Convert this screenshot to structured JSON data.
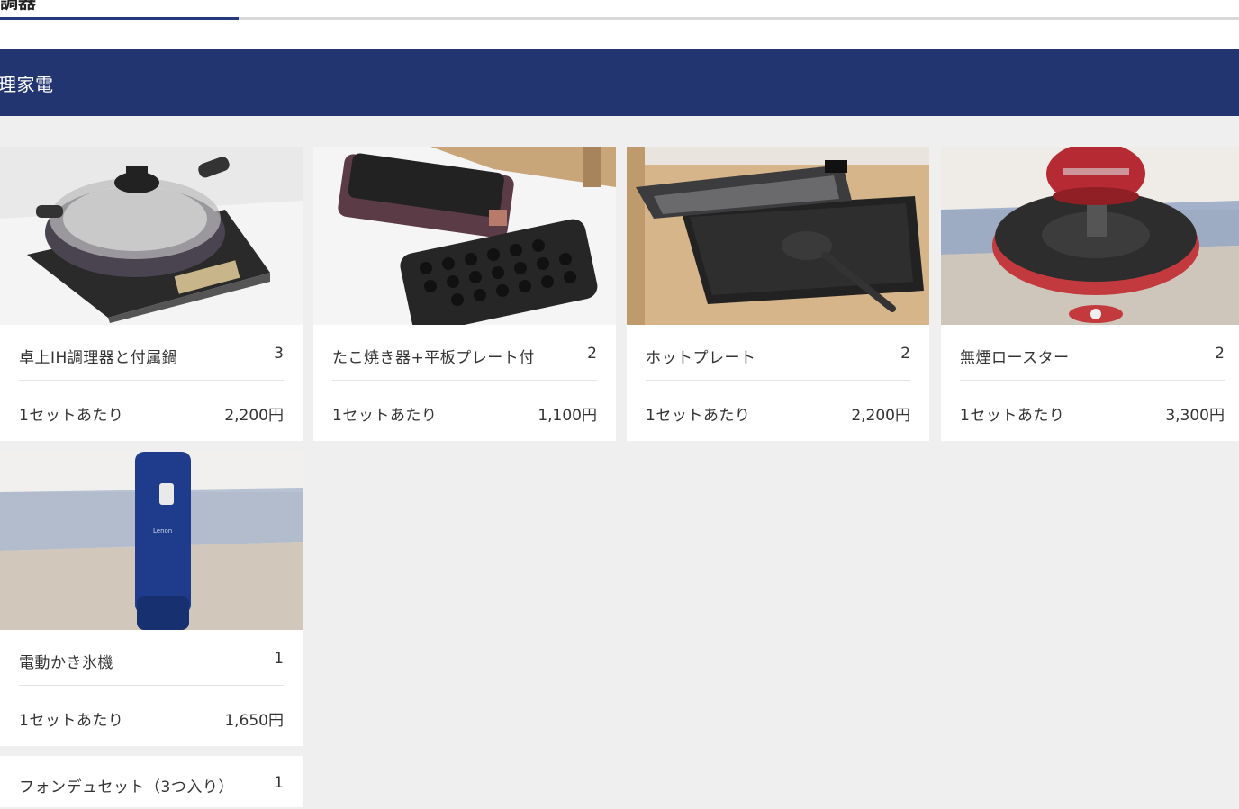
{
  "tab": {
    "title": "調器"
  },
  "category": {
    "label": "理家電"
  },
  "products": [
    {
      "name": "卓上IH調理器と付属鍋",
      "qty": "3",
      "unit": "1セットあたり",
      "price": "2,200円"
    },
    {
      "name": "たこ焼き器+平板プレート付",
      "qty": "2",
      "unit": "1セットあたり",
      "price": "1,100円"
    },
    {
      "name": "ホットプレート",
      "qty": "2",
      "unit": "1セットあたり",
      "price": "2,200円"
    },
    {
      "name": "無煙ロースター",
      "qty": "2",
      "unit": "1セットあたり",
      "price": "3,300円"
    },
    {
      "name": "電動かき氷機",
      "qty": "1",
      "unit": "1セットあたり",
      "price": "1,650円"
    },
    {
      "name": "フォンデュセット（3つ入り）",
      "qty": "1"
    }
  ],
  "colors": {
    "brand_navy": "#233571",
    "tab_active": "#243a7a",
    "page_bg": "#efefef"
  }
}
